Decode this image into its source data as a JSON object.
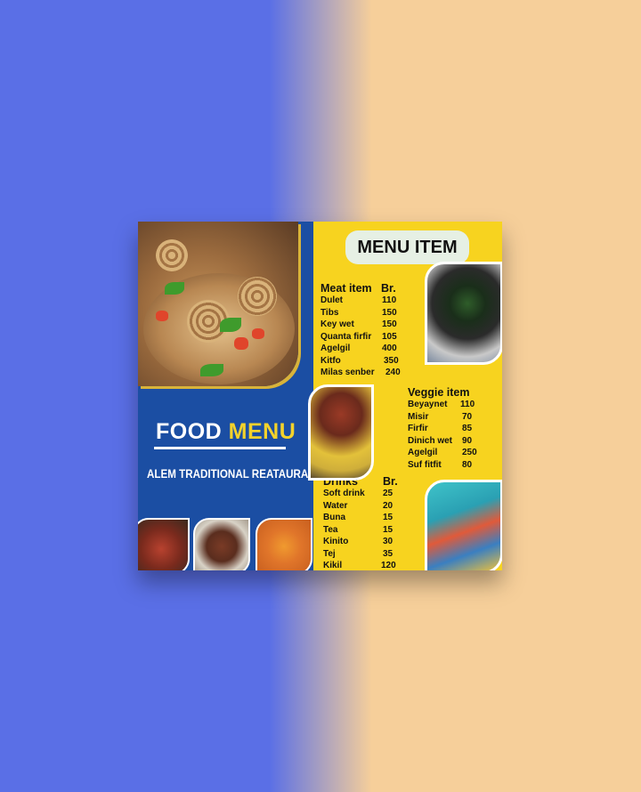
{
  "left": {
    "title_main": "FOOD",
    "title_accent": "MENU",
    "restaurant": "ALEM TRADITIONAL REATAURANT"
  },
  "right": {
    "badge": "MENU ITEM",
    "meat": {
      "title": "Meat item",
      "price_head": "Br.",
      "items": [
        {
          "name": "Dulet",
          "price": "110"
        },
        {
          "name": "Tibs",
          "price": "150"
        },
        {
          "name": "Key wet",
          "price": "150"
        },
        {
          "name": "Quanta firfir",
          "price": "105"
        },
        {
          "name": "Agelgil",
          "price": "400"
        },
        {
          "name": "Kitfo",
          "price": "350"
        },
        {
          "name": "Milas senber",
          "price": "240"
        }
      ]
    },
    "veggie": {
      "title": "Veggie item",
      "items": [
        {
          "name": "Beyaynet",
          "price": "110"
        },
        {
          "name": "Misir",
          "price": "70"
        },
        {
          "name": "Firfir",
          "price": "85"
        },
        {
          "name": "Dinich wet",
          "price": "90"
        },
        {
          "name": "Agelgil",
          "price": "250"
        },
        {
          "name": "Suf fitfit",
          "price": "80"
        }
      ]
    },
    "drinks": {
      "title": "Drinks",
      "price_head": "Br.",
      "items": [
        {
          "name": "Soft drink",
          "price": "25"
        },
        {
          "name": "Water",
          "price": "20"
        },
        {
          "name": "Buna",
          "price": "15"
        },
        {
          "name": "Tea",
          "price": "15"
        },
        {
          "name": "Kinito",
          "price": "30"
        },
        {
          "name": "Tej",
          "price": "35"
        },
        {
          "name": "Kikil",
          "price": "120"
        }
      ]
    }
  },
  "colors": {
    "left_panel": "#1b4ea3",
    "right_panel": "#f7d31f",
    "accent": "#f3d22b",
    "bg_left": "#5a6fe6",
    "bg_right": "#f6cf9a"
  }
}
